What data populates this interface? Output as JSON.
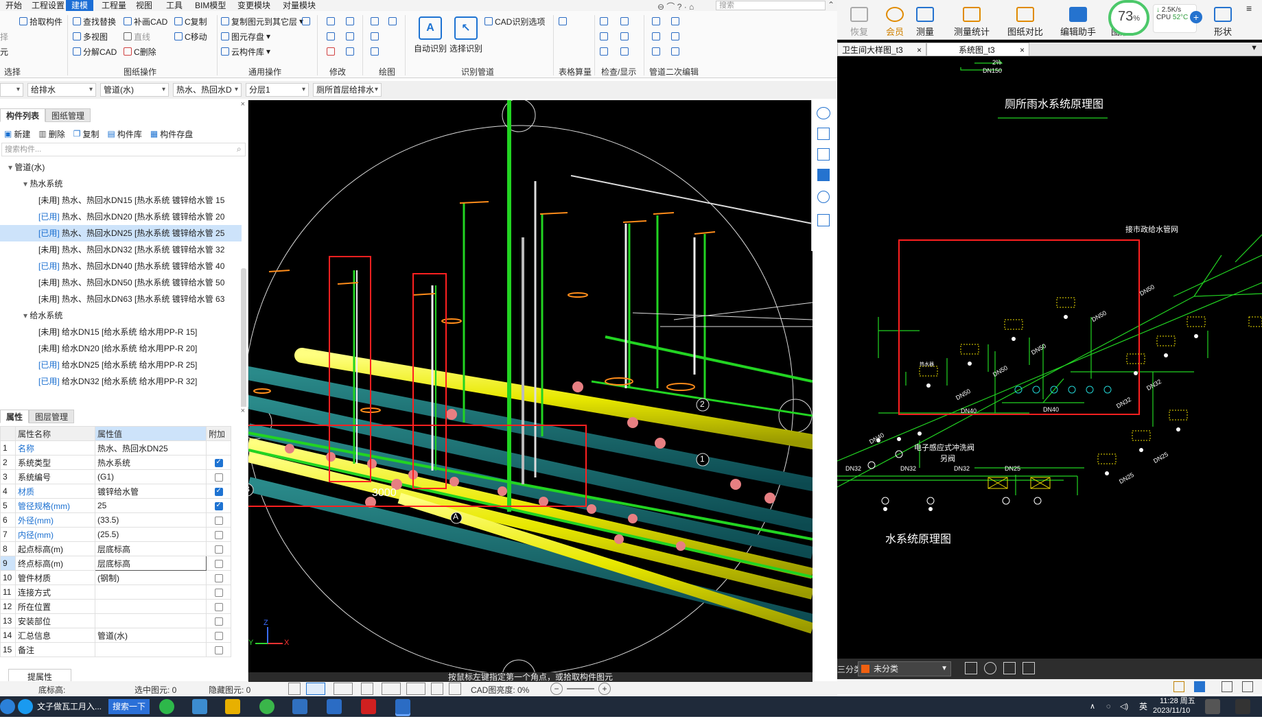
{
  "menu": {
    "items": [
      "开始",
      "工程设置",
      "建模",
      "工程量",
      "视图",
      "工具",
      "BIM模型",
      "变更模块",
      "对量模块"
    ],
    "active_index": 2,
    "search_placeholder": "搜索"
  },
  "ribbon": {
    "select": {
      "pick_label": "拾取构件",
      "side_a": "择",
      "side_b": "元",
      "group": "选择"
    },
    "drawing_ops": {
      "b1": "查找替换",
      "b2": "补画CAD",
      "b3": "C复制",
      "b4": "多视图",
      "b5": "直线",
      "b6": "C移动",
      "b7": "分解CAD",
      "b8": "C删除",
      "group": "图纸操作"
    },
    "common_ops": {
      "b1": "复制图元到其它层",
      "b2": "图元存盘",
      "b3": "云构件库",
      "group": "通用操作"
    },
    "modify": {
      "group": "修改"
    },
    "draw": {
      "group": "绘图"
    },
    "recognize": {
      "auto": "自动识别",
      "select": "选择识别",
      "cad_options": "CAD识别选项",
      "group": "识别管道"
    },
    "table": {
      "group": "表格算量"
    },
    "check": {
      "group": "检查/显示"
    },
    "secondary": {
      "group": "管道二次编辑"
    }
  },
  "filters": {
    "f1": "给排水",
    "f2": "管道(水)",
    "f3": "热水、热回水D",
    "f4": "分层1",
    "f5": "厕所首层给排水"
  },
  "left_panel": {
    "tabs": [
      "构件列表",
      "图纸管理"
    ],
    "toolbar": [
      "新建",
      "删除",
      "复制",
      "构件库",
      "构件存盘"
    ],
    "search_placeholder": "搜索构件...",
    "tree": [
      {
        "text": "管道(水)",
        "level": 0,
        "expanded": true
      },
      {
        "text": "热水系统",
        "level": 1,
        "expanded": true
      },
      {
        "status": "[未用]",
        "text": " 热水、热回水DN15 [热水系统 镀锌给水管 15",
        "level": 2
      },
      {
        "status": "[已用]",
        "text": " 热水、热回水DN20 [热水系统 镀锌给水管 20",
        "level": 2
      },
      {
        "status": "[已用]",
        "text": " 热水、热回水DN25 [热水系统 镀锌给水管 25",
        "level": 2,
        "selected": true
      },
      {
        "status": "[未用]",
        "text": " 热水、热回水DN32 [热水系统 镀锌给水管 32",
        "level": 2
      },
      {
        "status": "[已用]",
        "text": " 热水、热回水DN40 [热水系统 镀锌给水管 40",
        "level": 2
      },
      {
        "status": "[未用]",
        "text": " 热水、热回水DN50 [热水系统 镀锌给水管 50",
        "level": 2
      },
      {
        "status": "[未用]",
        "text": " 热水、热回水DN63 [热水系统 镀锌给水管 63",
        "level": 2
      },
      {
        "text": "给水系统",
        "level": 1,
        "expanded": true
      },
      {
        "status": "[未用]",
        "text": " 给水DN15 [给水系统 给水用PP-R 15]",
        "level": 2
      },
      {
        "status": "[未用]",
        "text": " 给水DN20 [给水系统 给水用PP-R 20]",
        "level": 2
      },
      {
        "status": "[已用]",
        "text": " 给水DN25 [给水系统 给水用PP-R 25]",
        "level": 2
      },
      {
        "status": "[已用]",
        "text": " 给水DN32 [给水系统 给水用PP-R 32]",
        "level": 2
      }
    ]
  },
  "props": {
    "tabs": [
      "属性",
      "图层管理"
    ],
    "headers": [
      "属性名称",
      "属性值",
      "附加"
    ],
    "rows": [
      {
        "n": "1",
        "name": "名称",
        "value": "热水、热回水DN25",
        "blue": true,
        "cb": null
      },
      {
        "n": "2",
        "name": "系统类型",
        "value": "热水系统",
        "blue": false,
        "cb": true
      },
      {
        "n": "3",
        "name": "系统编号",
        "value": "(G1)",
        "blue": false,
        "cb": false
      },
      {
        "n": "4",
        "name": "材质",
        "value": "镀锌给水管",
        "blue": true,
        "cb": true
      },
      {
        "n": "5",
        "name": "管径规格(mm)",
        "value": "25",
        "blue": true,
        "cb": true
      },
      {
        "n": "6",
        "name": "外径(mm)",
        "value": "(33.5)",
        "blue": true,
        "cb": false
      },
      {
        "n": "7",
        "name": "内径(mm)",
        "value": "(25.5)",
        "blue": true,
        "cb": false
      },
      {
        "n": "8",
        "name": "起点标高(m)",
        "value": "层底标高",
        "blue": false,
        "cb": false
      },
      {
        "n": "9",
        "name": "终点标高(m)",
        "value": "层底标高",
        "blue": false,
        "cb": false
      },
      {
        "n": "10",
        "name": "管件材质",
        "value": "(钢制)",
        "blue": false,
        "cb": false
      },
      {
        "n": "11",
        "name": "连接方式",
        "value": "",
        "blue": false,
        "cb": false
      },
      {
        "n": "12",
        "name": "所在位置",
        "value": "",
        "blue": false,
        "cb": false
      },
      {
        "n": "13",
        "name": "安装部位",
        "value": "",
        "blue": false,
        "cb": false
      },
      {
        "n": "14",
        "name": "汇总信息",
        "value": "管道(水)",
        "blue": false,
        "cb": false
      },
      {
        "n": "15",
        "name": "备注",
        "value": "",
        "blue": false,
        "cb": false
      }
    ],
    "button": "提属性"
  },
  "status": {
    "floor_height": "底标高:",
    "selected": "选中图元: 0",
    "hidden": "隐藏图元: 0",
    "cad_brightness": "CAD图亮度: 0%"
  },
  "view3d": {
    "hint": "按鼠标左键指定第一个角点，或拾取构件图元",
    "label_3000": "3000",
    "axis_a": "A",
    "axis_b": "B",
    "axis_1": "1",
    "axis_2": "2",
    "axis_z": "Z",
    "axis_y": "Y",
    "axis_x": "X"
  },
  "right": {
    "toolbar": [
      "恢复",
      "会员",
      "测量",
      "测量统计",
      "图纸对比",
      "编辑助手",
      "图形",
      "形状"
    ],
    "tabs": [
      "卫生间大样图_t3",
      "系统图_t3"
    ],
    "cad_title1": "厕所雨水系统原理图",
    "cad_title2": "水系统原理图",
    "cad_labels": {
      "dn150": "DN150",
      "slope": "2%",
      "top_note": "接市政给水管网",
      "dn50a": "DN50",
      "dn50b": "DN50",
      "dn50c": "DN50",
      "dn50d": "DN50",
      "dn40a": "DN40",
      "dn40b": "DN40",
      "dn40c": "DN40",
      "dn32a": "DN32",
      "dn32b": "DN32",
      "dn32c": "DN32",
      "dn32d": "DN32",
      "dn25a": "DN25",
      "dn25b": "DN25",
      "dn25c": "DN25",
      "heater": "热水器",
      "flush": "电子感应式冲洗阀",
      "flush2": "另阀"
    },
    "category_label": "三分类",
    "category_value": "未分类"
  },
  "cpu": {
    "percent": "73",
    "unit": "%",
    "net": "2.5K/s",
    "cpu_label": "CPU",
    "temp": "52°C"
  },
  "taskbar": {
    "browser_title": "文子做瓦工月入...",
    "search_btn": "搜索一下",
    "ime": "英",
    "time": "11:28 周五",
    "date": "2023/11/10"
  }
}
